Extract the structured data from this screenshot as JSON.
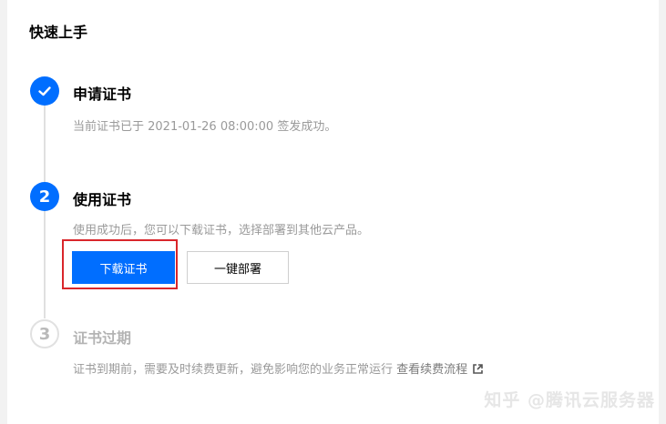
{
  "panel": {
    "title": "快速上手"
  },
  "steps": [
    {
      "state": "done",
      "icon": "check-icon",
      "title": "申请证书",
      "description": "当前证书已于 2021-01-26 08:00:00 签发成功。"
    },
    {
      "state": "active",
      "number": "2",
      "title": "使用证书",
      "description": "使用成功后，您可以下载证书，选择部署到其他云产品。",
      "actions": {
        "download_label": "下载证书",
        "deploy_label": "一键部署"
      }
    },
    {
      "state": "pending",
      "number": "3",
      "title": "证书过期",
      "description": "证书到期前，需要及时续费更新，避免影响您的业务正常运行",
      "link_label": "查看续费流程",
      "link_icon": "external-link-icon"
    }
  ],
  "colors": {
    "accent": "#006eff",
    "highlight": "#d9262b"
  },
  "watermark": "知乎 @腾讯云服务器"
}
